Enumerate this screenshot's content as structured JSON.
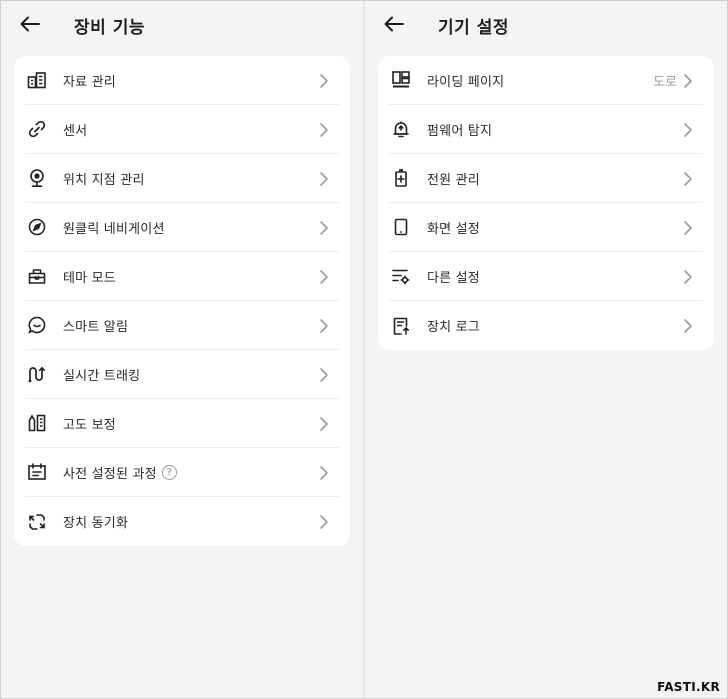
{
  "left_panel": {
    "title": "장비 기능",
    "items": [
      {
        "label": "자료 관리",
        "icon": "data-management-icon"
      },
      {
        "label": "센서",
        "icon": "sensor-link-icon"
      },
      {
        "label": "위치 지점 관리",
        "icon": "location-pin-icon"
      },
      {
        "label": "원클릭 네비게이션",
        "icon": "compass-navigation-icon"
      },
      {
        "label": "테마 모드",
        "icon": "theme-mode-icon"
      },
      {
        "label": "스마트 알림",
        "icon": "smart-notification-icon"
      },
      {
        "label": "실시간 트래킹",
        "icon": "route-tracking-icon"
      },
      {
        "label": "고도 보정",
        "icon": "altitude-calibration-icon"
      },
      {
        "label": "사전 설정된 과정",
        "icon": "preset-course-icon",
        "help": "?"
      },
      {
        "label": "장치 동기화",
        "icon": "sync-icon"
      }
    ]
  },
  "right_panel": {
    "title": "기기 설정",
    "items": [
      {
        "label": "라이딩 페이지",
        "icon": "riding-page-icon",
        "value": "도로"
      },
      {
        "label": "펌웨어 탐지",
        "icon": "firmware-bell-icon"
      },
      {
        "label": "전원 관리",
        "icon": "battery-icon"
      },
      {
        "label": "화면 설정",
        "icon": "screen-icon"
      },
      {
        "label": "다른 설정",
        "icon": "other-settings-icon"
      },
      {
        "label": "장치 로그",
        "icon": "device-log-icon"
      }
    ]
  },
  "watermark": "FASTI.KR",
  "colors": {
    "panel_bg": "#f4f4f6",
    "card_bg": "#ffffff",
    "text": "#2a2a2a",
    "muted": "#9a9a9a",
    "divider": "#ececec"
  }
}
